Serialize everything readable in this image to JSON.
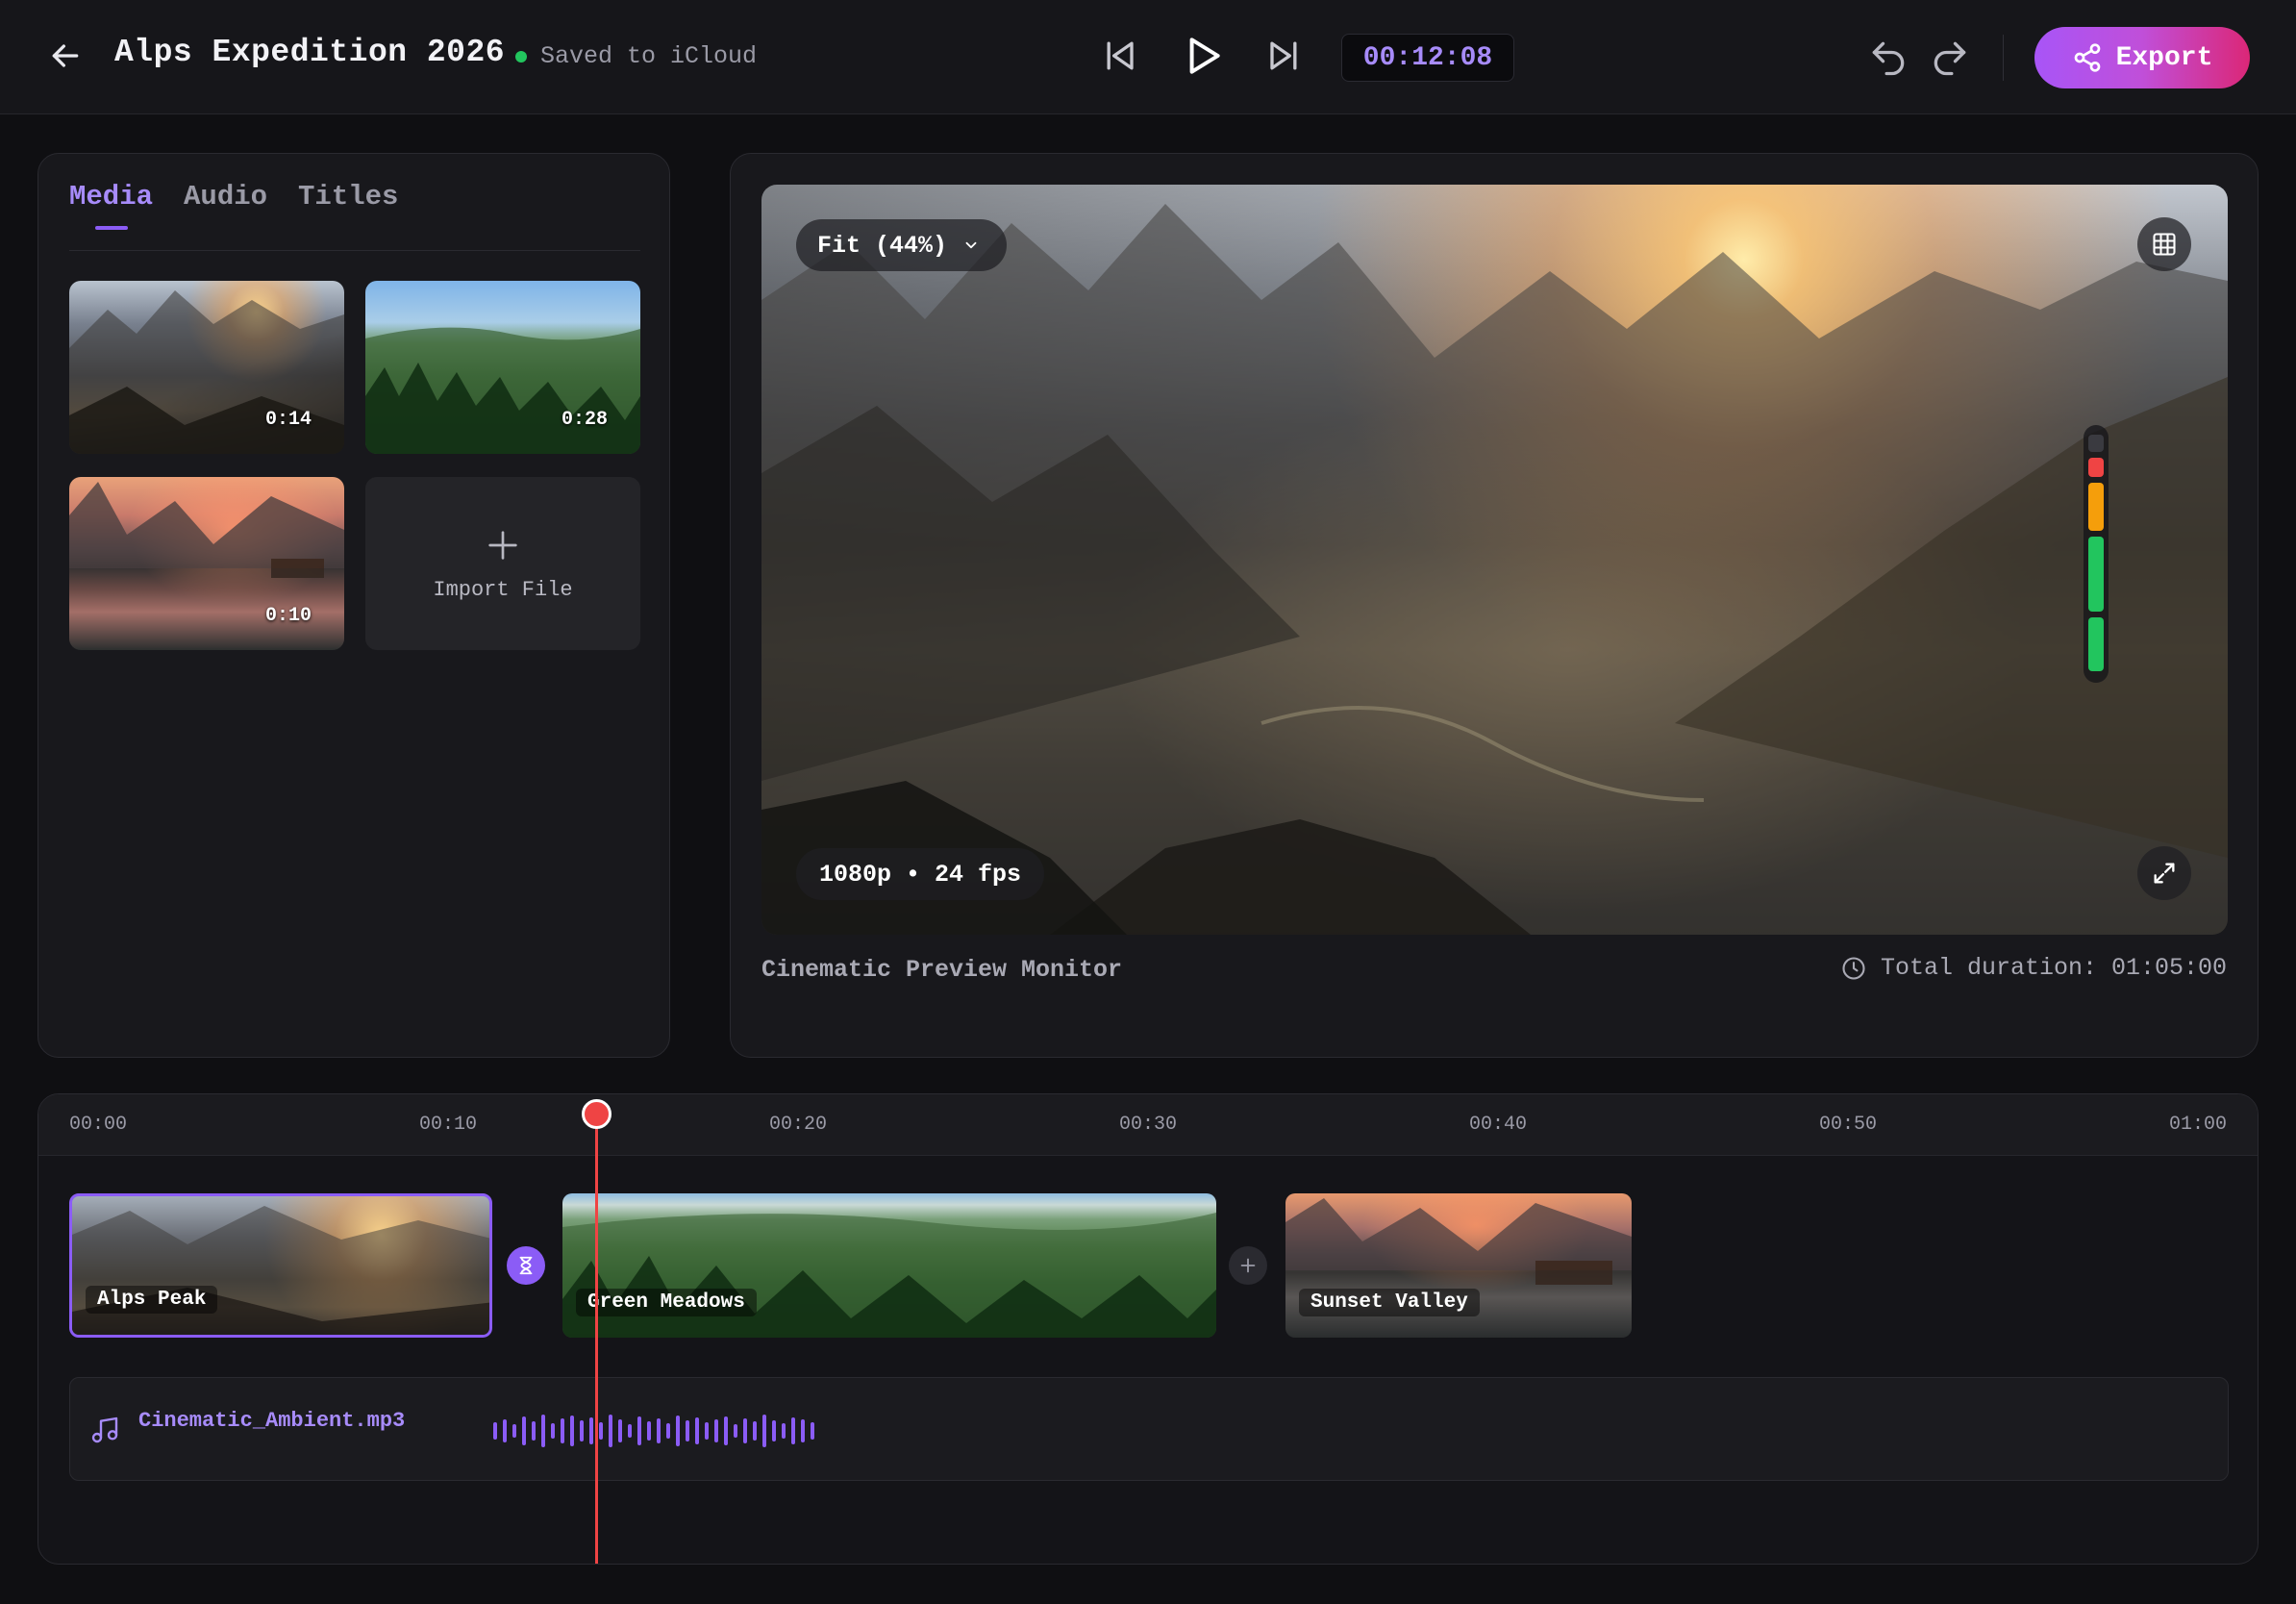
{
  "header": {
    "title": "Alps Expedition 2026",
    "save_status": "Saved to iCloud",
    "timecode": "00:12:08",
    "export_label": "Export",
    "colors": {
      "accent": "#8b5cf6",
      "export_gradient": [
        "#a855f7",
        "#db2777"
      ],
      "saved_dot": "#22c55e"
    }
  },
  "library": {
    "tabs": [
      {
        "label": "Media",
        "active": true
      },
      {
        "label": "Audio",
        "active": false
      },
      {
        "label": "Titles",
        "active": false
      }
    ],
    "items": [
      {
        "duration": "0:14"
      },
      {
        "duration": "0:28"
      },
      {
        "duration": "0:10"
      }
    ],
    "import_label": "Import File"
  },
  "preview": {
    "fit_label": "Fit (44%)",
    "resolution_label": "1080p • 24 fps",
    "caption": "Cinematic Preview Monitor",
    "total_duration": "Total duration: 01:05:00"
  },
  "timeline": {
    "ruler_ticks": [
      "00:00",
      "00:10",
      "00:20",
      "00:30",
      "00:40",
      "00:50",
      "01:00"
    ],
    "clips": [
      {
        "label": "Alps Peak",
        "selected": true
      },
      {
        "label": "Green Meadows",
        "selected": false
      },
      {
        "label": "Sunset Valley",
        "selected": false
      }
    ],
    "audio": {
      "file_name": "Cinematic_Ambient.mp3"
    },
    "playhead_color": "#ef4444"
  }
}
